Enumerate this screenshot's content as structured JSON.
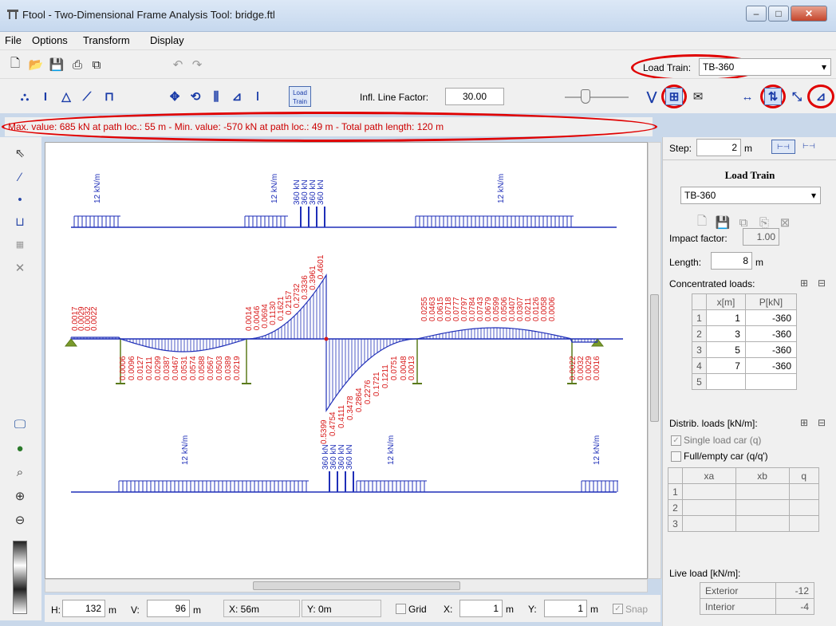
{
  "window": {
    "title": "Ftool - Two-Dimensional Frame Analysis Tool: bridge.ftl"
  },
  "menu": [
    "File",
    "Options",
    "Transform",
    "Display"
  ],
  "toolbar": {
    "load_train_label": "Load Train:",
    "load_train_value": "TB-360",
    "infl_label": "Infl. Line Factor:",
    "infl_value": "30.00",
    "load_train_button": "Load Train"
  },
  "status_message": "Max. value: 685 kN at path loc.: 55 m  -  Min. value: -570 kN at path loc.: 49 m  -  Total path length: 120 m",
  "step": {
    "label": "Step:",
    "value": "2",
    "unit": "m"
  },
  "panel": {
    "title": "Load Train",
    "train_value": "TB-360",
    "impact_label": "Impact factor:",
    "impact_value": "1.00",
    "length_label": "Length:",
    "length_value": "8",
    "length_unit": "m",
    "conc_label": "Concentrated loads:",
    "conc_headers": [
      "x[m]",
      "P[kN]"
    ],
    "conc_rows": [
      {
        "n": "1",
        "x": "1",
        "p": "-360"
      },
      {
        "n": "2",
        "x": "3",
        "p": "-360"
      },
      {
        "n": "3",
        "x": "5",
        "p": "-360"
      },
      {
        "n": "4",
        "x": "7",
        "p": "-360"
      },
      {
        "n": "5",
        "x": "",
        "p": ""
      }
    ],
    "dist_label": "Distrib. loads [kN/m]:",
    "single_car": "Single load car (q)",
    "full_empty": "Full/empty car (q/q')",
    "dist_headers": [
      "xa",
      "xb",
      "q"
    ],
    "dist_rows": [
      "1",
      "2",
      "3"
    ],
    "live_label": "Live load [kN/m]:",
    "live_rows": [
      {
        "name": "Exterior",
        "value": "-12"
      },
      {
        "name": "Interior",
        "value": "-4"
      }
    ]
  },
  "bottom": {
    "h_label": "H:",
    "h_value": "132",
    "h_unit": "m",
    "v_label": "V:",
    "v_value": "96",
    "v_unit": "m",
    "x_coord": "X: 56m",
    "y_coord": "Y: 0m",
    "grid_label": "Grid",
    "x_label": "X:",
    "x_value": "1",
    "x_unit": "m",
    "y_label": "Y:",
    "y_value": "1",
    "y_unit": "m",
    "snap_label": "Snap"
  },
  "drawing": {
    "dist_load": "12 kN/m",
    "conc_load": "360 kN",
    "top_positive": [
      "0.0255",
      "0.0463",
      "0.0615",
      "0.0718",
      "0.0777",
      "0.0797",
      "0.0784",
      "0.0743",
      "0.0679",
      "0.0599",
      "0.0506",
      "0.0407",
      "0.0307",
      "0.0211",
      "0.0126",
      "0.0058",
      "0.0006"
    ],
    "top_left": [
      "0.0017",
      "0.0029",
      "0.0032",
      "0.0022"
    ],
    "rise": [
      "0.0014",
      "0.0046",
      "0.0694",
      "0.1130",
      "0.1621",
      "0.2157",
      "0.2732",
      "0.3336",
      "0.3961",
      "0.4601"
    ],
    "drop": [
      "0.5399",
      "0.4754",
      "0.4111",
      "0.3478",
      "0.2864",
      "0.2276",
      "0.1721",
      "0.1211",
      "0.0751"
    ],
    "bottom_left": [
      "0.0006",
      "0.0096",
      "0.0127",
      "0.0211",
      "0.0299",
      "0.0387",
      "0.0467",
      "0.0531",
      "0.0574",
      "0.0588",
      "0.0567",
      "0.0503",
      "0.0389",
      "0.0219"
    ],
    "bottom_mid": [
      "0.0048",
      "0.0013"
    ],
    "bottom_right": [
      "0.0022",
      "0.0032",
      "0.0029",
      "0.0016"
    ]
  },
  "colors": {
    "red_highlight": "#e00000",
    "diagram_blue": "#1f2fb8",
    "label_red": "#d81818",
    "support_green": "#5a7a1a"
  }
}
